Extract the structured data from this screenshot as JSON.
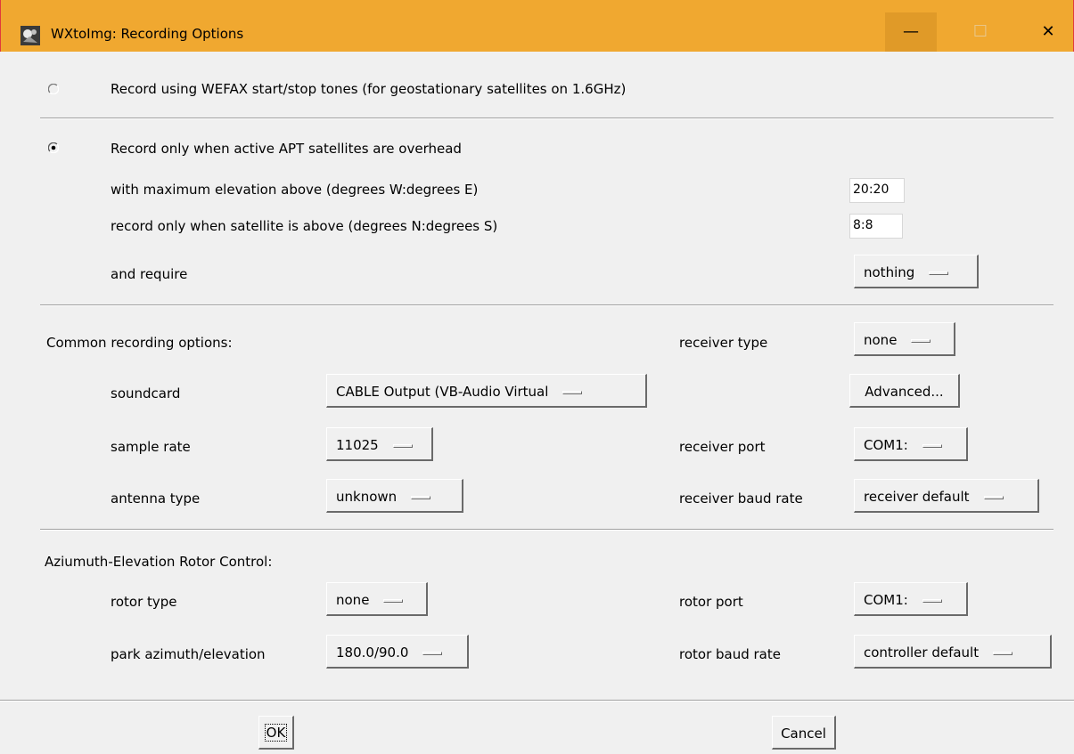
{
  "window": {
    "title": "WXtoImg: Recording Options",
    "titlebar_color": "#f0a830",
    "controls": {
      "minimize": "—",
      "maximize": "☐",
      "close": "✕"
    }
  },
  "wefax": {
    "label": "Record using WEFAX start/stop tones (for geostationary satellites on 1.6GHz)",
    "selected": false
  },
  "apt": {
    "label": "Record only when active APT satellites are overhead",
    "selected": true,
    "max_elevation_label": "with maximum elevation above (degrees W:degrees E)",
    "max_elevation_value": "20:20",
    "above_label": "record only when satellite is above (degrees N:degrees S)",
    "above_value": "8:8",
    "require_label": "and require",
    "require_value": "nothing"
  },
  "common": {
    "heading": "Common recording options:",
    "receiver_type_label": "receiver type",
    "receiver_type_value": "none",
    "soundcard_label": "soundcard",
    "soundcard_value": "CABLE Output (VB-Audio Virtual",
    "advanced_label": "Advanced...",
    "sample_rate_label": "sample rate",
    "sample_rate_value": "11025",
    "receiver_port_label": "receiver port",
    "receiver_port_value": "COM1:",
    "antenna_type_label": "antenna type",
    "antenna_type_value": "unknown",
    "receiver_baud_label": "receiver baud rate",
    "receiver_baud_value": "receiver default"
  },
  "rotor": {
    "heading": "Aziumuth-Elevation Rotor Control:",
    "rotor_type_label": "rotor type",
    "rotor_type_value": "none",
    "rotor_port_label": "rotor port",
    "rotor_port_value": "COM1:",
    "park_label": "park azimuth/elevation",
    "park_value": "180.0/90.0",
    "rotor_baud_label": "rotor baud rate",
    "rotor_baud_value": "controller default"
  },
  "buttons": {
    "ok": "OK",
    "cancel": "Cancel"
  }
}
